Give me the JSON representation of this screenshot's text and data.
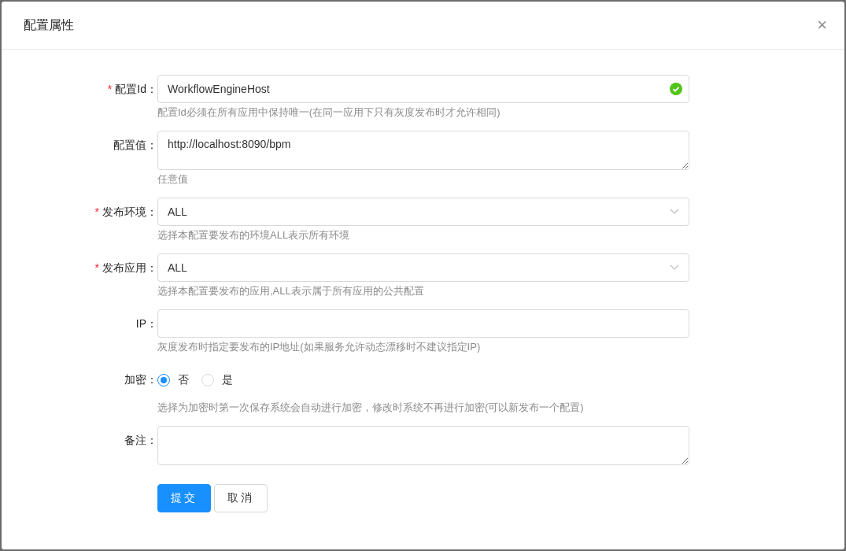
{
  "dialog": {
    "title": "配置属性",
    "close": "×"
  },
  "fields": [
    {
      "kind": "input",
      "mark": "*",
      "label": "配置Id：",
      "value": "WorkflowEngineHost",
      "valid": true,
      "help": "配置Id必须在所有应用中保持唯一(在同一应用下只有灰度发布时才允许相同)"
    },
    {
      "kind": "textarea",
      "label": "配置值：",
      "value": "http://localhost:8090/bpm",
      "help": "任意值"
    },
    {
      "kind": "select",
      "mark": "*",
      "label": "发布环境：",
      "value": "ALL",
      "help": "选择本配置要发布的环境ALL表示所有环境"
    },
    {
      "kind": "select",
      "mark": "*",
      "label": "发布应用：",
      "value": "ALL",
      "help": "选择本配置要发布的应用,ALL表示属于所有应用的公共配置"
    },
    {
      "kind": "input",
      "label": "IP：",
      "help": "灰度发布时指定要发布的IP地址(如果服务允许动态漂移时不建议指定IP)"
    },
    {
      "kind": "radio",
      "label": "加密：",
      "options": [
        {
          "label": "否",
          "selected": true
        },
        {
          "label": "是",
          "selected": false
        }
      ],
      "help": "选择为加密时第一次保存系统会自动进行加密，修改时系统不再进行加密(可以新发布一个配置)"
    },
    {
      "kind": "textarea",
      "label": "备注："
    }
  ],
  "buttons": [
    {
      "label": "提交",
      "kind": "primary"
    },
    {
      "label": "取消",
      "kind": "default"
    }
  ]
}
